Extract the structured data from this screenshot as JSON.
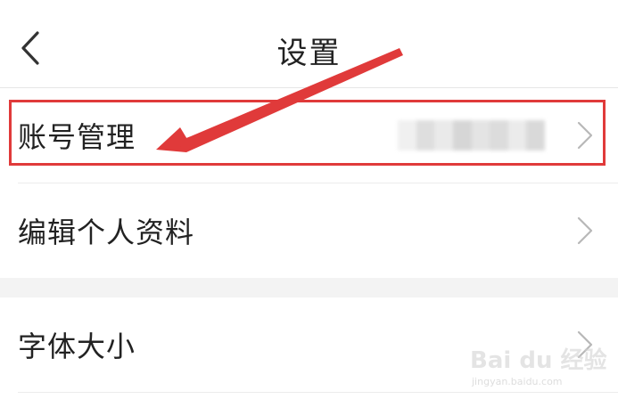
{
  "header": {
    "title": "设置",
    "back_icon": "chevron-left-icon"
  },
  "settings": {
    "items": [
      {
        "label": "账号管理",
        "value_blurred": true,
        "chevron": "chevron-right-icon"
      },
      {
        "label": "编辑个人资料",
        "chevron": "chevron-right-icon"
      },
      {
        "label": "字体大小",
        "chevron": "chevron-right-icon"
      }
    ]
  },
  "annotation": {
    "color": "#e03a3a"
  },
  "watermark": {
    "text": "Bai du 经验",
    "url": "jingyan.baidu.com"
  }
}
